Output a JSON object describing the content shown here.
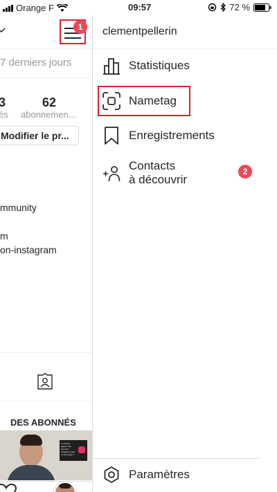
{
  "status_bar": {
    "carrier": "Orange F",
    "time": "09:57",
    "battery": "72 %"
  },
  "profile_bg": {
    "notification_count": "1",
    "period_text": "7 derniers jours",
    "stat_a_value": "3",
    "stat_a_label": "és",
    "stat_b_value": "62",
    "stat_b_label": "abonnemen...",
    "edit_button": "Modifier le pr...",
    "bio_line1": "mmunity",
    "bio_line2": "m",
    "bio_line3": "on-instagram",
    "section_title": "DES ABONNÉS",
    "thumb_box_text": "Comment gagner des abonnés Instagram avec un Nametag ?"
  },
  "drawer": {
    "username": "clementpellerin",
    "items": [
      {
        "label": "Statistiques",
        "icon": "bar-chart-icon"
      },
      {
        "label": "Nametag",
        "icon": "nametag-icon"
      },
      {
        "label": "Enregistrements",
        "icon": "bookmark-icon"
      },
      {
        "label_line1": "Contacts",
        "label_line2": "à découvrir",
        "icon": "add-person-icon",
        "badge": "2"
      }
    ],
    "settings": "Paramètres"
  },
  "colors": {
    "highlight": "#e0202a",
    "badge": "#ed4956",
    "text": "#262626",
    "muted": "#999999"
  }
}
